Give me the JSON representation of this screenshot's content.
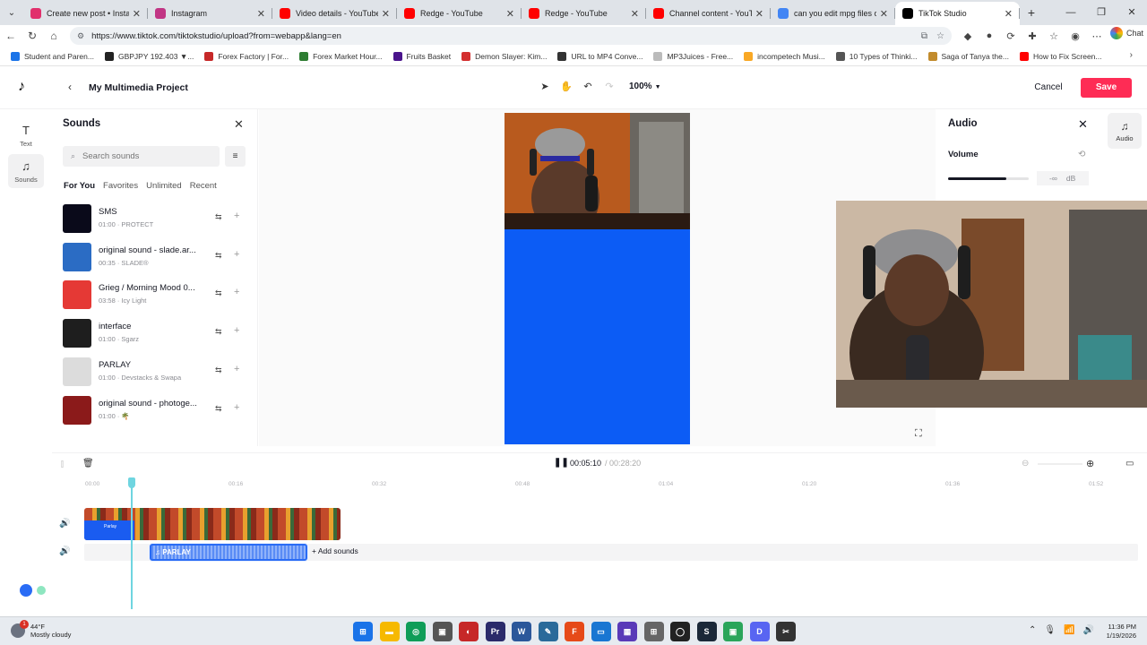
{
  "browser": {
    "tabs": [
      {
        "title": "Create new post • Instagram",
        "color": "#e1306c",
        "active": false
      },
      {
        "title": "Instagram",
        "color": "#c13584",
        "active": false
      },
      {
        "title": "Video details - YouTube Stud",
        "color": "#ff0000",
        "active": false
      },
      {
        "title": "Redge - YouTube",
        "color": "#ff0000",
        "active": false
      },
      {
        "title": "Redge - YouTube",
        "color": "#ff0000",
        "active": false
      },
      {
        "title": "Channel content - YouTube",
        "color": "#ff0000",
        "active": false
      },
      {
        "title": "can you edit mpg files on ca",
        "color": "#4285f4",
        "active": false
      },
      {
        "title": "TikTok Studio",
        "color": "#000000",
        "active": true
      }
    ],
    "url": "https://www.tiktok.com/tiktokstudio/upload?from=webapp&lang=en",
    "chat_label": "Chat",
    "bookmarks": [
      {
        "label": "Student and Paren...",
        "color": "#1a73e8"
      },
      {
        "label": "GBPJPY 192.403 ▼...",
        "color": "#222222"
      },
      {
        "label": "Forex Factory | For...",
        "color": "#c62828"
      },
      {
        "label": "Forex Market Hour...",
        "color": "#2e7d32"
      },
      {
        "label": "Fruits Basket",
        "color": "#4a148c"
      },
      {
        "label": "Demon Slayer: Kim...",
        "color": "#d32f2f"
      },
      {
        "label": "URL to MP4 Conve...",
        "color": "#333333"
      },
      {
        "label": "MP3Juices - Free...",
        "color": "#bbbbbb"
      },
      {
        "label": "incompetech Musi...",
        "color": "#f9a825"
      },
      {
        "label": "10 Types of Thinki...",
        "color": "#555555"
      },
      {
        "label": "Saga of Tanya the...",
        "color": "#c28b2c"
      },
      {
        "label": "How to Fix Screen...",
        "color": "#ff0000"
      }
    ]
  },
  "app": {
    "project_title": "My Multimedia Project",
    "zoom": "100%",
    "cancel_label": "Cancel",
    "save_label": "Save",
    "rail": {
      "text_label": "Text",
      "sounds_label": "Sounds"
    }
  },
  "sounds": {
    "title": "Sounds",
    "search_placeholder": "Search sounds",
    "tabs": [
      "For You",
      "Favorites",
      "Unlimited",
      "Recent"
    ],
    "items": [
      {
        "name": "SMS",
        "meta": "01:00 · PROTECT",
        "cover": "#0a0a1a"
      },
      {
        "name": "original sound - slade.ar...",
        "meta": "00:35 · SLADE®",
        "cover": "#2b6cc4"
      },
      {
        "name": "Grieg / Morning Mood 0...",
        "meta": "03:58 · Icy Light",
        "cover": "#e53935"
      },
      {
        "name": "interface",
        "meta": "01:00 · Sgarz",
        "cover": "#1e1e1e"
      },
      {
        "name": "PARLAY",
        "meta": "01:00 · Devstacks & Swapa",
        "cover": "#dcdcdc"
      },
      {
        "name": "original sound - photoge...",
        "meta": "01:00 · 🌴",
        "cover": "#8b1a1a"
      }
    ]
  },
  "audio_panel": {
    "title": "Audio",
    "volume_label": "Volume",
    "volume_value": "-∞",
    "volume_unit": "dB",
    "volume_level": 0.72,
    "rail_label": "Audio"
  },
  "timeline": {
    "current_time": "00:05:10",
    "total_time": "/ 00:28:20",
    "ruler": [
      "00:00",
      "00:16",
      "00:32",
      "00:48",
      "01:04",
      "01:20",
      "01:36",
      "01:52"
    ],
    "audio_clip_label": "PARLAY",
    "add_sounds_label": "+ Add sounds",
    "video_clip_label": "Parlay"
  },
  "taskbar": {
    "weather_temp": "44°F",
    "weather_desc": "Mostly cloudy",
    "weather_badge": "1",
    "time": "11:36 PM",
    "date": "1/19/2026"
  }
}
